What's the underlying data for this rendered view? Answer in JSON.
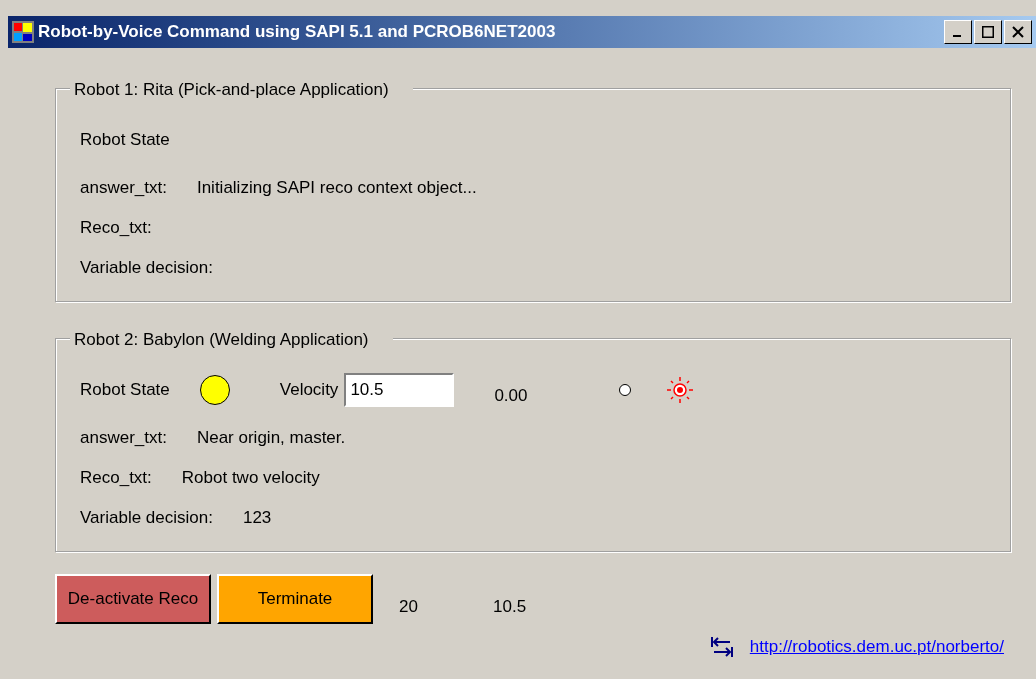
{
  "window": {
    "title": "Robot-by-Voice Command using SAPI 5.1 and PCROB6NET2003"
  },
  "groups": [
    {
      "title": "Robot 1:  Rita (Pick-and-place Application)",
      "state_label": "Robot State",
      "fields": [
        {
          "label": "answer_txt:",
          "value": "Initializing SAPI reco context object..."
        },
        {
          "label": "Reco_txt:"
        },
        {
          "label": "Variable decision:"
        }
      ]
    },
    {
      "title": "Robot 2:  Babylon (Welding Application)",
      "state_label": "Robot State",
      "color": "#ffff00",
      "velocity": {
        "label": "Velocity",
        "value": "10.5",
        "reading": "0.00"
      },
      "fields": [
        {
          "label": "answer_txt:",
          "value": "Near origin, master."
        },
        {
          "label": "Reco_txt:",
          "value": "Robot two velocity"
        },
        {
          "label": "Variable decision:",
          "value": "123"
        }
      ]
    }
  ],
  "buttons": [
    {
      "label": "De-activate Reco",
      "color": "#cd5c5c"
    },
    {
      "label": "Terminate",
      "color": "#ffa500"
    }
  ],
  "readings": [
    "20",
    "10.5"
  ],
  "link": "http://robotics.dem.uc.pt/norberto/"
}
